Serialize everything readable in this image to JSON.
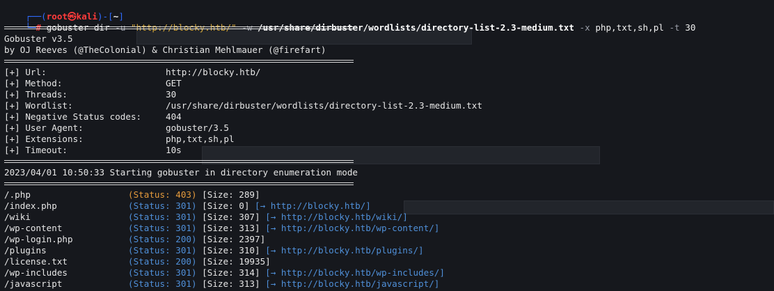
{
  "prompt": {
    "user": "root",
    "at": "㉿",
    "host": "kali",
    "dir": "~",
    "hash": "#"
  },
  "command": {
    "base": "gobuster dir ",
    "flag_u": "-u ",
    "url": "\"http://blocky.htb/\"",
    "flag_w": " -w ",
    "wordlist": "/usr/share/dirbuster/wordlists/directory-list-2.3-medium.txt",
    "flag_x": " -x ",
    "extensions": "php,txt,sh,pl",
    "flag_t": " -t ",
    "threads": "30"
  },
  "banner": {
    "version": "Gobuster v3.5",
    "authors": "by OJ Reeves (@TheColonial) & Christian Mehlmauer (@firefart)"
  },
  "config": [
    {
      "key": "[+] Url:",
      "value": "http://blocky.htb/"
    },
    {
      "key": "[+] Method:",
      "value": "GET"
    },
    {
      "key": "[+] Threads:",
      "value": "30"
    },
    {
      "key": "[+] Wordlist:",
      "value": "/usr/share/dirbuster/wordlists/directory-list-2.3-medium.txt"
    },
    {
      "key": "[+] Negative Status codes:",
      "value": "404"
    },
    {
      "key": "[+] User Agent:",
      "value": "gobuster/3.5"
    },
    {
      "key": "[+] Extensions:",
      "value": "php,txt,sh,pl"
    },
    {
      "key": "[+] Timeout:",
      "value": "10s"
    }
  ],
  "start_message": "2023/04/01 10:50:33 Starting gobuster in directory enumeration mode",
  "results": [
    {
      "path": "/.php",
      "status": "(Status: 403)",
      "size": "[Size: 289]",
      "redirect": ""
    },
    {
      "path": "/index.php",
      "status": "(Status: 301)",
      "size": "[Size: 0]",
      "redirect": "[→ http://blocky.htb/]"
    },
    {
      "path": "/wiki",
      "status": "(Status: 301)",
      "size": "[Size: 307]",
      "redirect": "[→ http://blocky.htb/wiki/]"
    },
    {
      "path": "/wp-content",
      "status": "(Status: 301)",
      "size": "[Size: 313]",
      "redirect": "[→ http://blocky.htb/wp-content/]"
    },
    {
      "path": "/wp-login.php",
      "status": "(Status: 200)",
      "size": "[Size: 2397]",
      "redirect": ""
    },
    {
      "path": "/plugins",
      "status": "(Status: 301)",
      "size": "[Size: 310]",
      "redirect": "[→ http://blocky.htb/plugins/]"
    },
    {
      "path": "/license.txt",
      "status": "(Status: 200)",
      "size": "[Size: 19935]",
      "redirect": ""
    },
    {
      "path": "/wp-includes",
      "status": "(Status: 301)",
      "size": "[Size: 314]",
      "redirect": "[→ http://blocky.htb/wp-includes/]"
    },
    {
      "path": "/javascript",
      "status": "(Status: 301)",
      "size": "[Size: 313]",
      "redirect": "[→ http://blocky.htb/javascript/]"
    }
  ],
  "colors": {
    "background": "#16181d",
    "status_403": "#e49a3c",
    "status_ok": "#4f8fd8",
    "prompt_user": "#ff3b3b",
    "prompt_frame": "#2f6bff"
  }
}
